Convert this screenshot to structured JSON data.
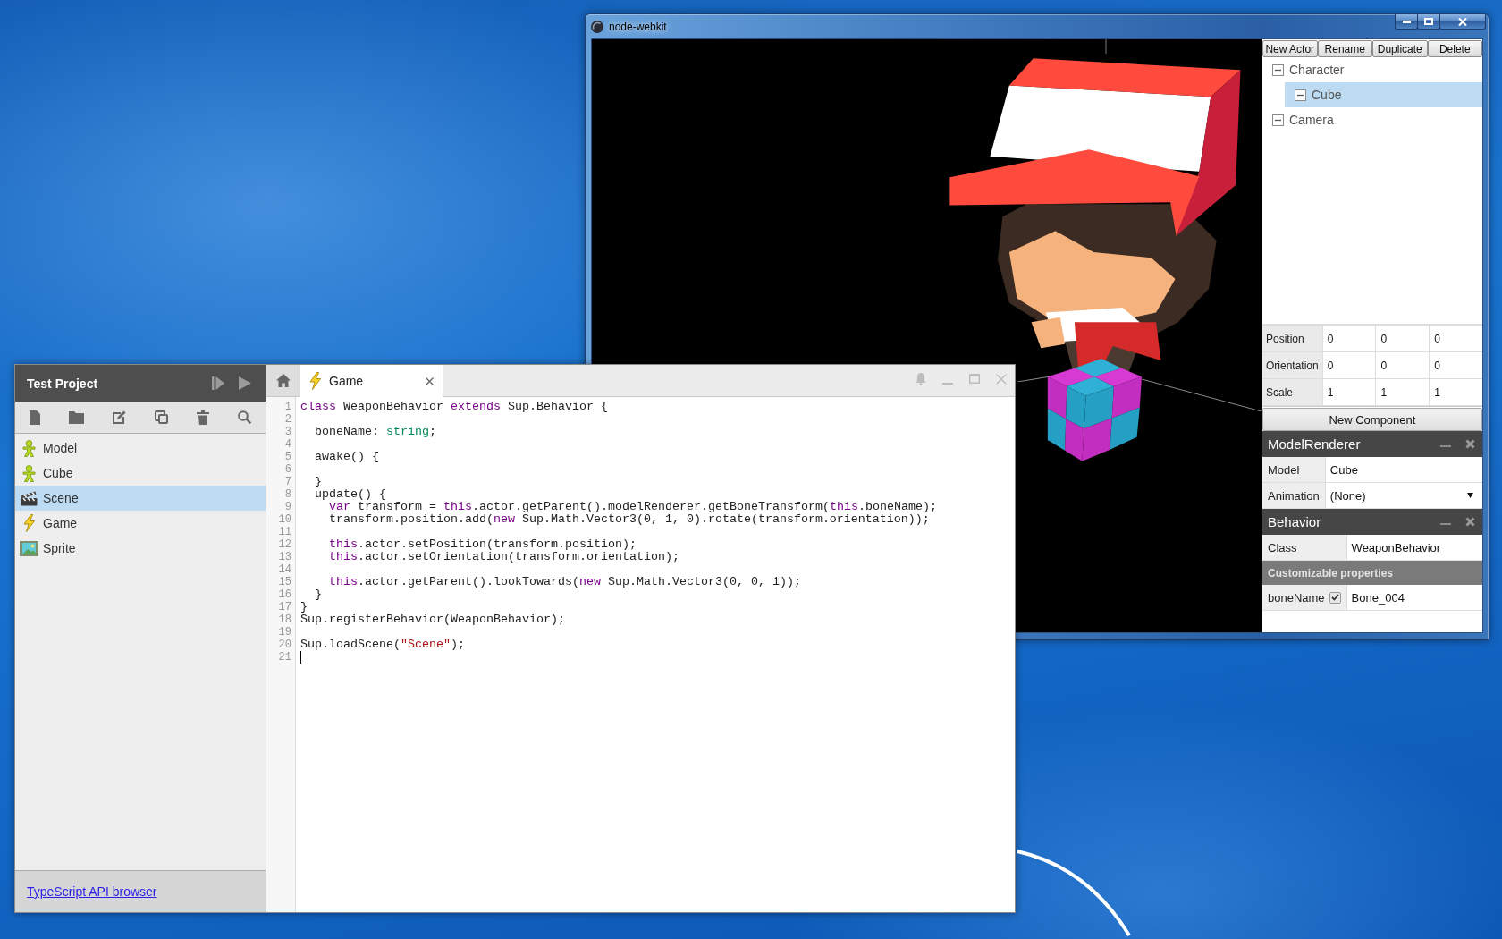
{
  "main_window": {
    "title": "node-webkit",
    "actor_toolbar": [
      "New Actor",
      "Rename",
      "Duplicate",
      "Delete"
    ],
    "actor_tree": [
      {
        "label": "Character",
        "expanded": true,
        "selected": false,
        "children": [
          {
            "label": "Cube",
            "expanded": true,
            "selected": true
          }
        ]
      },
      {
        "label": "Camera",
        "expanded": true,
        "selected": false
      }
    ],
    "transform": [
      {
        "label": "Position",
        "values": [
          "0",
          "0",
          "0"
        ]
      },
      {
        "label": "Orientation",
        "values": [
          "0",
          "0",
          "0"
        ]
      },
      {
        "label": "Scale",
        "values": [
          "1",
          "1",
          "1"
        ]
      }
    ],
    "new_component_button": "New Component",
    "components": [
      {
        "title": "ModelRenderer",
        "rows": [
          {
            "kind": "text",
            "label": "Model",
            "value": "Cube"
          },
          {
            "kind": "select",
            "label": "Animation",
            "value": "(None)"
          }
        ]
      },
      {
        "title": "Behavior",
        "rows": [
          {
            "kind": "text",
            "label": "Class",
            "value": "WeaponBehavior"
          },
          {
            "kind": "section",
            "label": "Customizable properties"
          },
          {
            "kind": "property",
            "label": "boneName",
            "checked": true,
            "value": "Bone_004"
          }
        ]
      }
    ]
  },
  "project_window": {
    "title": "Test Project",
    "assets": [
      {
        "label": "Model",
        "kind": "model",
        "selected": false
      },
      {
        "label": "Cube",
        "kind": "model",
        "selected": false
      },
      {
        "label": "Scene",
        "kind": "scene",
        "selected": true
      },
      {
        "label": "Game",
        "kind": "script",
        "selected": false
      },
      {
        "label": "Sprite",
        "kind": "sprite",
        "selected": false
      }
    ],
    "footer_link": "TypeScript API browser"
  },
  "editor": {
    "tabs": [
      {
        "label": "Game",
        "kind": "script",
        "selected": true
      }
    ],
    "lines": [
      {
        "number": "1",
        "cursor": false,
        "segments": [
          {
            "text": "class",
            "kind": "keyword"
          },
          {
            "text": " WeaponBehavior ",
            "kind": "plain"
          },
          {
            "text": "extends",
            "kind": "keyword"
          },
          {
            "text": " Sup.Behavior {",
            "kind": "plain"
          }
        ]
      },
      {
        "number": "2",
        "cursor": false
      },
      {
        "number": "3",
        "cursor": false,
        "segments": [
          {
            "text": "  boneName: ",
            "kind": "plain"
          },
          {
            "text": "string",
            "kind": "type"
          },
          {
            "text": ";",
            "kind": "plain"
          }
        ]
      },
      {
        "number": "4",
        "cursor": false
      },
      {
        "number": "5",
        "cursor": false,
        "segments": [
          {
            "text": "  awake() {",
            "kind": "plain"
          }
        ]
      },
      {
        "number": "6",
        "cursor": false
      },
      {
        "number": "7",
        "cursor": false,
        "segments": [
          {
            "text": "  }",
            "kind": "plain"
          }
        ]
      },
      {
        "number": "8",
        "cursor": false,
        "segments": [
          {
            "text": "  update() {",
            "kind": "plain"
          }
        ]
      },
      {
        "number": "9",
        "cursor": false,
        "segments": [
          {
            "text": "    var",
            "kind": "keyword"
          },
          {
            "text": " transform = ",
            "kind": "plain"
          },
          {
            "text": "this",
            "kind": "keyword"
          },
          {
            "text": ".actor.getParent().modelRenderer.getBoneTransform(",
            "kind": "plain"
          },
          {
            "text": "this",
            "kind": "keyword"
          },
          {
            "text": ".boneName);",
            "kind": "plain"
          }
        ]
      },
      {
        "number": "10",
        "cursor": false,
        "segments": [
          {
            "text": "    transform.position.add(",
            "kind": "plain"
          },
          {
            "text": "new",
            "kind": "keyword"
          },
          {
            "text": " Sup.Math.Vector3(0, 1, 0).rotate(transform.orientation));",
            "kind": "plain"
          }
        ]
      },
      {
        "number": "11",
        "cursor": false
      },
      {
        "number": "12",
        "cursor": false,
        "segments": [
          {
            "text": "    this",
            "kind": "keyword"
          },
          {
            "text": ".actor.setPosition(transform.position);",
            "kind": "plain"
          }
        ]
      },
      {
        "number": "13",
        "cursor": false,
        "segments": [
          {
            "text": "    this",
            "kind": "keyword"
          },
          {
            "text": ".actor.setOrientation(transform.orientation);",
            "kind": "plain"
          }
        ]
      },
      {
        "number": "14",
        "cursor": false
      },
      {
        "number": "15",
        "cursor": false,
        "segments": [
          {
            "text": "    this",
            "kind": "keyword"
          },
          {
            "text": ".actor.getParent().lookTowards(",
            "kind": "plain"
          },
          {
            "text": "new",
            "kind": "keyword"
          },
          {
            "text": " Sup.Math.Vector3(0, 0, 1));",
            "kind": "plain"
          }
        ]
      },
      {
        "number": "16",
        "cursor": false,
        "segments": [
          {
            "text": "  }",
            "kind": "plain"
          }
        ]
      },
      {
        "number": "17",
        "cursor": false,
        "segments": [
          {
            "text": "}",
            "kind": "plain"
          }
        ]
      },
      {
        "number": "18",
        "cursor": false,
        "segments": [
          {
            "text": "Sup.registerBehavior(WeaponBehavior);",
            "kind": "plain"
          }
        ]
      },
      {
        "number": "19",
        "cursor": false
      },
      {
        "number": "20",
        "cursor": false,
        "segments": [
          {
            "text": "Sup.loadScene(",
            "kind": "plain"
          },
          {
            "text": "\"Scene\"",
            "kind": "string"
          },
          {
            "text": ");",
            "kind": "plain"
          }
        ]
      },
      {
        "number": "21",
        "cursor": true
      }
    ]
  }
}
